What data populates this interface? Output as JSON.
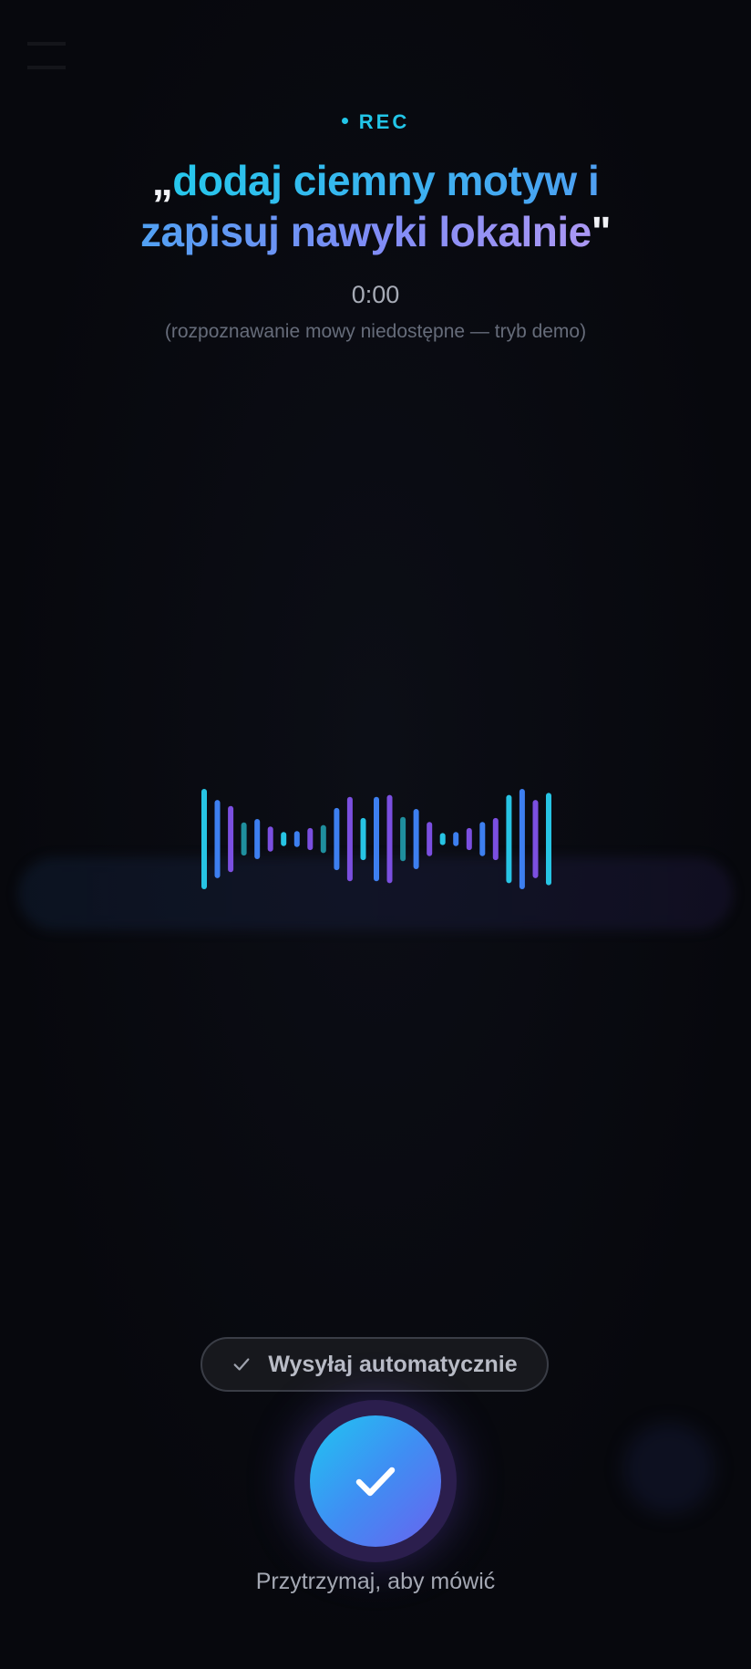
{
  "colors": {
    "background": "#07080d",
    "accent_cyan": "#22c6e8",
    "accent_blue": "#4aa3f2",
    "accent_violet": "#7f8cf6",
    "bar_cyan": "#27c4e4",
    "bar_blue": "#3d7ff0",
    "bar_violet": "#7b4fe0",
    "bar_teal": "#1f8f9e"
  },
  "recording": {
    "indicator_label": "REC",
    "transcript_open_quote": "„",
    "transcript_text": "dodaj ciemny motyw i zapisuj nawyki lokalnie",
    "transcript_close_quote": "\"",
    "timer": "0:00",
    "note": "(rozpoznawanie mowy niedostępne — tryb demo)"
  },
  "waveform": {
    "levels": [
      1.0,
      0.78,
      0.66,
      0.33,
      0.4,
      0.25,
      0.14,
      0.16,
      0.22,
      0.28,
      0.62,
      0.84,
      0.42,
      0.84,
      0.88,
      0.44,
      0.6,
      0.34,
      0.12,
      0.14,
      0.22,
      0.34,
      0.42,
      0.88,
      1.0,
      0.78,
      0.92
    ],
    "colors": [
      "cyan",
      "blue",
      "violet",
      "teal",
      "blue",
      "violet",
      "cyan",
      "blue",
      "violet",
      "teal",
      "blue",
      "violet",
      "cyan",
      "blue",
      "violet",
      "teal",
      "blue",
      "violet",
      "cyan",
      "blue",
      "violet",
      "blue",
      "violet",
      "cyan",
      "blue",
      "violet",
      "cyan"
    ]
  },
  "controls": {
    "auto_send_label": "Wysyłaj automatycznie",
    "auto_send_checked": true,
    "confirm_icon": "check-icon",
    "hold_label": "Przytrzymaj, aby mówić"
  }
}
